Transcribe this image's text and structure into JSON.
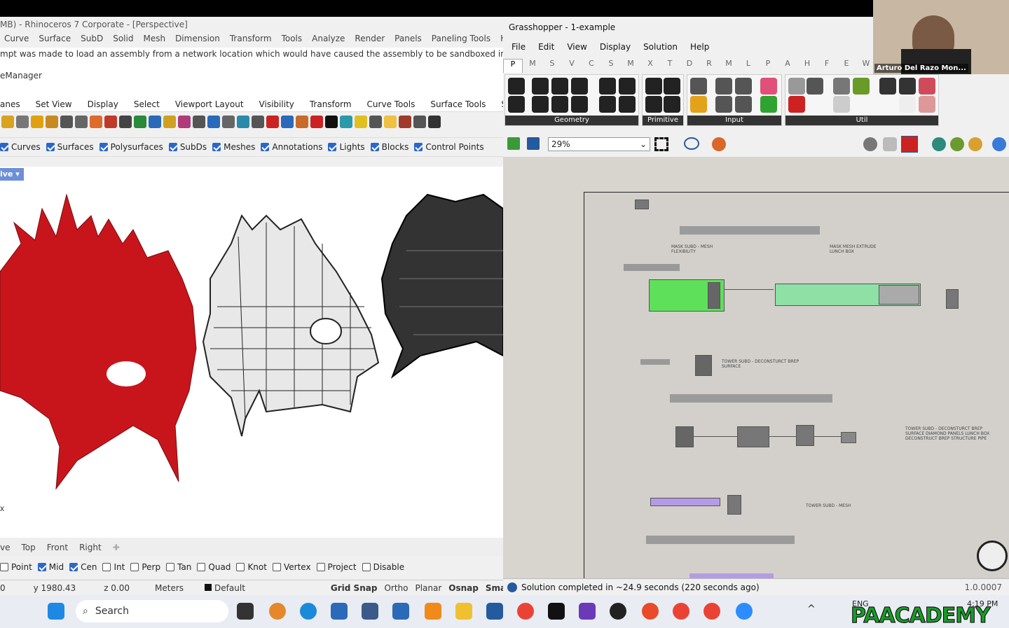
{
  "rhino": {
    "title": "MB) - Rhinoceros 7 Corporate - [Perspective]",
    "menu": [
      "Curve",
      "Surface",
      "SubD",
      "Solid",
      "Mesh",
      "Dimension",
      "Transform",
      "Tools",
      "Analyze",
      "Render",
      "Panels",
      "Paneling Tools",
      "Help"
    ],
    "command_line_1": "mpt was made to load an assembly from a network location which would have caused the assembly to be sandboxed in previous versio",
    "command_line_2": "eManager",
    "toolbar_tabs": [
      "anes",
      "Set View",
      "Display",
      "Select",
      "Viewport Layout",
      "Visibility",
      "Transform",
      "Curve Tools",
      "Surface Tools",
      "Solid To"
    ],
    "filters": [
      {
        "label": "Curves",
        "checked": true
      },
      {
        "label": "Surfaces",
        "checked": true
      },
      {
        "label": "Polysurfaces",
        "checked": true
      },
      {
        "label": "SubDs",
        "checked": true
      },
      {
        "label": "Meshes",
        "checked": true
      },
      {
        "label": "Annotations",
        "checked": true
      },
      {
        "label": "Lights",
        "checked": true
      },
      {
        "label": "Blocks",
        "checked": true
      },
      {
        "label": "Control Points",
        "checked": true
      }
    ],
    "viewport_tab": "ive",
    "axis_label": "x",
    "view_tabs": [
      "ve",
      "Top",
      "Front",
      "Right"
    ],
    "osnaps": [
      {
        "label": "Point",
        "checked": false
      },
      {
        "label": "Mid",
        "checked": true
      },
      {
        "label": "Cen",
        "checked": true
      },
      {
        "label": "Int",
        "checked": false
      },
      {
        "label": "Perp",
        "checked": false
      },
      {
        "label": "Tan",
        "checked": false
      },
      {
        "label": "Quad",
        "checked": false
      },
      {
        "label": "Knot",
        "checked": false
      },
      {
        "label": "Vertex",
        "checked": false
      },
      {
        "label": "Project",
        "checked": false
      },
      {
        "label": "Disable",
        "checked": false
      }
    ],
    "status": {
      "x": "0",
      "y": "y 1980.43",
      "z": "z 0.00",
      "units": "Meters",
      "layer": "Default",
      "toggles": [
        "Grid Snap",
        "Ortho",
        "Planar",
        "Osnap",
        "SmartTrac"
      ]
    }
  },
  "grasshopper": {
    "title": "Grasshopper - 1-example",
    "menu": [
      "File",
      "Edit",
      "View",
      "Display",
      "Solution",
      "Help"
    ],
    "tabs": [
      "P",
      "M",
      "S",
      "V",
      "C",
      "S",
      "M",
      "X",
      "T",
      "D",
      "R",
      "M",
      "L",
      "P",
      "A",
      "H",
      "F",
      "E",
      "W"
    ],
    "ribbon_groups": [
      "Geometry",
      "Primitive",
      "Input",
      "Util"
    ],
    "zoom": "29%",
    "notes": [
      "Mask Subd - Mesh Flexibility",
      "Mask Mesh Extrude Lunch Box",
      "Tower SubD - Deconsturct Brep Surface",
      "Tower SubD - Deconsturct Brep Surface Diamond Panels Lunch Box Deconstruct Brep Structure Pipe",
      "Tower SubD - Mesh"
    ],
    "status": "Solution completed in ~24.9 seconds (220 seconds ago)",
    "version": "1.0.0007"
  },
  "webcam": {
    "name": "Arturo Del Razo Mon..."
  },
  "taskbar": {
    "search": "Search",
    "lang": "ENG",
    "time": "4:19 PM",
    "brand": "PAACADEMY"
  },
  "colors": {
    "mask_red": "#c8151c",
    "gh_green": "#5ee05a",
    "gh_purple": "#b59be6",
    "win_blue": "#2a67c9"
  }
}
